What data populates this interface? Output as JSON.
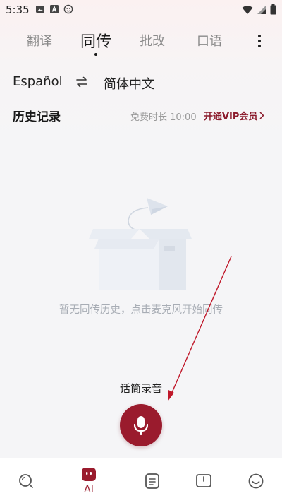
{
  "status_bar": {
    "time": "5:35",
    "icons": [
      "image-icon",
      "a-box-icon",
      "face-scan-icon"
    ],
    "right_icons": [
      "wifi-icon",
      "signal-icon",
      "battery-icon"
    ]
  },
  "tabs": [
    {
      "label": "翻译",
      "active": false
    },
    {
      "label": "同传",
      "active": true
    },
    {
      "label": "批改",
      "active": false
    },
    {
      "label": "口语",
      "active": false
    }
  ],
  "language": {
    "source": "Español",
    "swap_icon": "swap-arrows-icon",
    "target": "简体中文"
  },
  "history": {
    "title": "历史记录",
    "free_time": "免费时长 10:00",
    "vip_label": "开通VIP会员"
  },
  "empty_state": {
    "text": "暂无同传历史，点击麦克风开始同传"
  },
  "record": {
    "label": "话筒录音"
  },
  "bottom_nav": [
    {
      "icon": "search-icon",
      "label": ""
    },
    {
      "icon": "ai-robot-icon",
      "label": "AI"
    },
    {
      "icon": "notes-icon",
      "label": ""
    },
    {
      "icon": "book-icon",
      "label": ""
    },
    {
      "icon": "smile-icon",
      "label": ""
    }
  ],
  "colors": {
    "accent": "#9a1b2d",
    "vip": "#8b1a2b",
    "muted_text": "#9a9a9a",
    "arrow": "#c0182a"
  }
}
